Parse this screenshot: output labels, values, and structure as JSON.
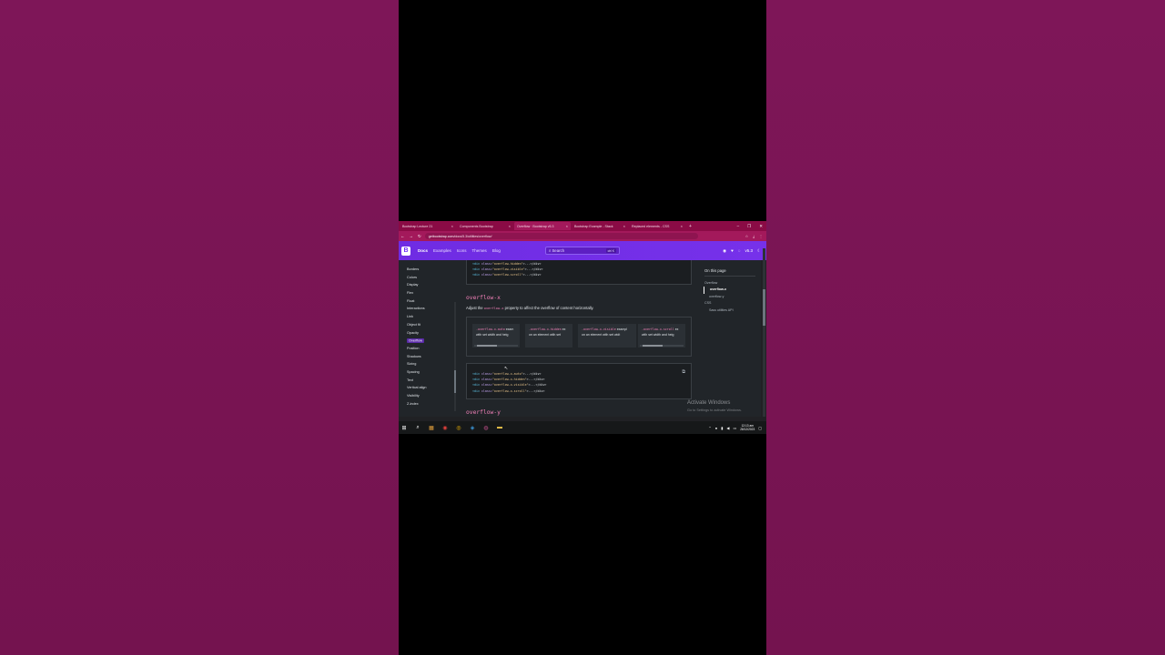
{
  "browser": {
    "tabs": [
      {
        "label": "Bootstrap Lecture 21"
      },
      {
        "label": "Components Bootstrap"
      },
      {
        "label": "Overflow · Bootstrap v5.3"
      },
      {
        "label": "Bootstrap Example - Stack"
      },
      {
        "label": "Replaced elements - CSS"
      }
    ],
    "url_host": "getbootstrap.com",
    "url_path": "/docs/5.3/utilities/overflow/"
  },
  "navbar": {
    "brand": "B",
    "links": [
      "Docs",
      "Examples",
      "Icons",
      "Themes",
      "Blog"
    ],
    "search_placeholder": "Search",
    "search_shortcut": "ctrl K",
    "version": "v5.3"
  },
  "sidenav": {
    "items": [
      "Borders",
      "Colors",
      "Display",
      "Flex",
      "Float",
      "Interactions",
      "Link",
      "Object fit",
      "Opacity",
      "Overflow",
      "Position",
      "Shadows",
      "Sizing",
      "Spacing",
      "Text",
      "Vertical align",
      "Visibility",
      "Z-index"
    ],
    "active_index": 9
  },
  "main": {
    "top_code": [
      {
        "tag": "<div",
        "attr": " class=",
        "val": "\"overflow-hidden\"",
        "rest": ">...</div>"
      },
      {
        "tag": "<div",
        "attr": " class=",
        "val": "\"overflow-visible\"",
        "rest": ">...</div>"
      },
      {
        "tag": "<div",
        "attr": " class=",
        "val": "\"overflow-scroll\"",
        "rest": ">...</div>"
      }
    ],
    "heading_x": "overflow-x",
    "desc_prefix": "Adjust the",
    "desc_code": "overflow-x",
    "desc_suffix": "property to affect the overflow of content horizontally.",
    "examples": [
      {
        "code": ".overflow-x-auto",
        "text1": " exam",
        "text2": "with set width and heig"
      },
      {
        "code": ".overflow-x-hidden",
        "text1": " ex",
        "text2": "on an element with set"
      },
      {
        "code": ".overflow-x-visible",
        "text1": " exampl",
        "text2": "on an element with set widt"
      },
      {
        "code": ".overflow-x-scroll",
        "text1": " ex",
        "text2": "with set width and heig"
      }
    ],
    "code_x": [
      {
        "tag": "<div",
        "attr": " class=",
        "val": "\"overflow-x-auto\"",
        "rest": ">...</div>"
      },
      {
        "tag": "<div",
        "attr": " class=",
        "val": "\"overflow-x-hidden\"",
        "rest": ">...</div>"
      },
      {
        "tag": "<div",
        "attr": " class=",
        "val": "\"overflow-x-visible\"",
        "rest": ">...</div>"
      },
      {
        "tag": "<div",
        "attr": " class=",
        "val": "\"overflow-x-scroll\"",
        "rest": ">...</div>"
      }
    ],
    "heading_y": "overflow-y"
  },
  "toc": {
    "title": "On this page",
    "items": [
      {
        "label": "Overflow",
        "depth": 0,
        "active": false
      },
      {
        "label": "overflow-x",
        "depth": 1,
        "active": true
      },
      {
        "label": "overflow-y",
        "depth": 1,
        "active": false
      },
      {
        "label": "CSS",
        "depth": 0,
        "active": false
      },
      {
        "label": "Sass utilities API",
        "depth": 1,
        "active": false
      }
    ]
  },
  "watermark": {
    "title": "Activate Windows",
    "subtitle": "Go to Settings to activate Windows."
  },
  "taskbar": {
    "time": "12:13 am",
    "date": "28/12/2023"
  },
  "colors": {
    "bootstrap_purple": "#712cf9",
    "chrome_tab_pink": "#a3195b",
    "code_pink": "#f180b8",
    "outer_background": "#7c1656"
  }
}
